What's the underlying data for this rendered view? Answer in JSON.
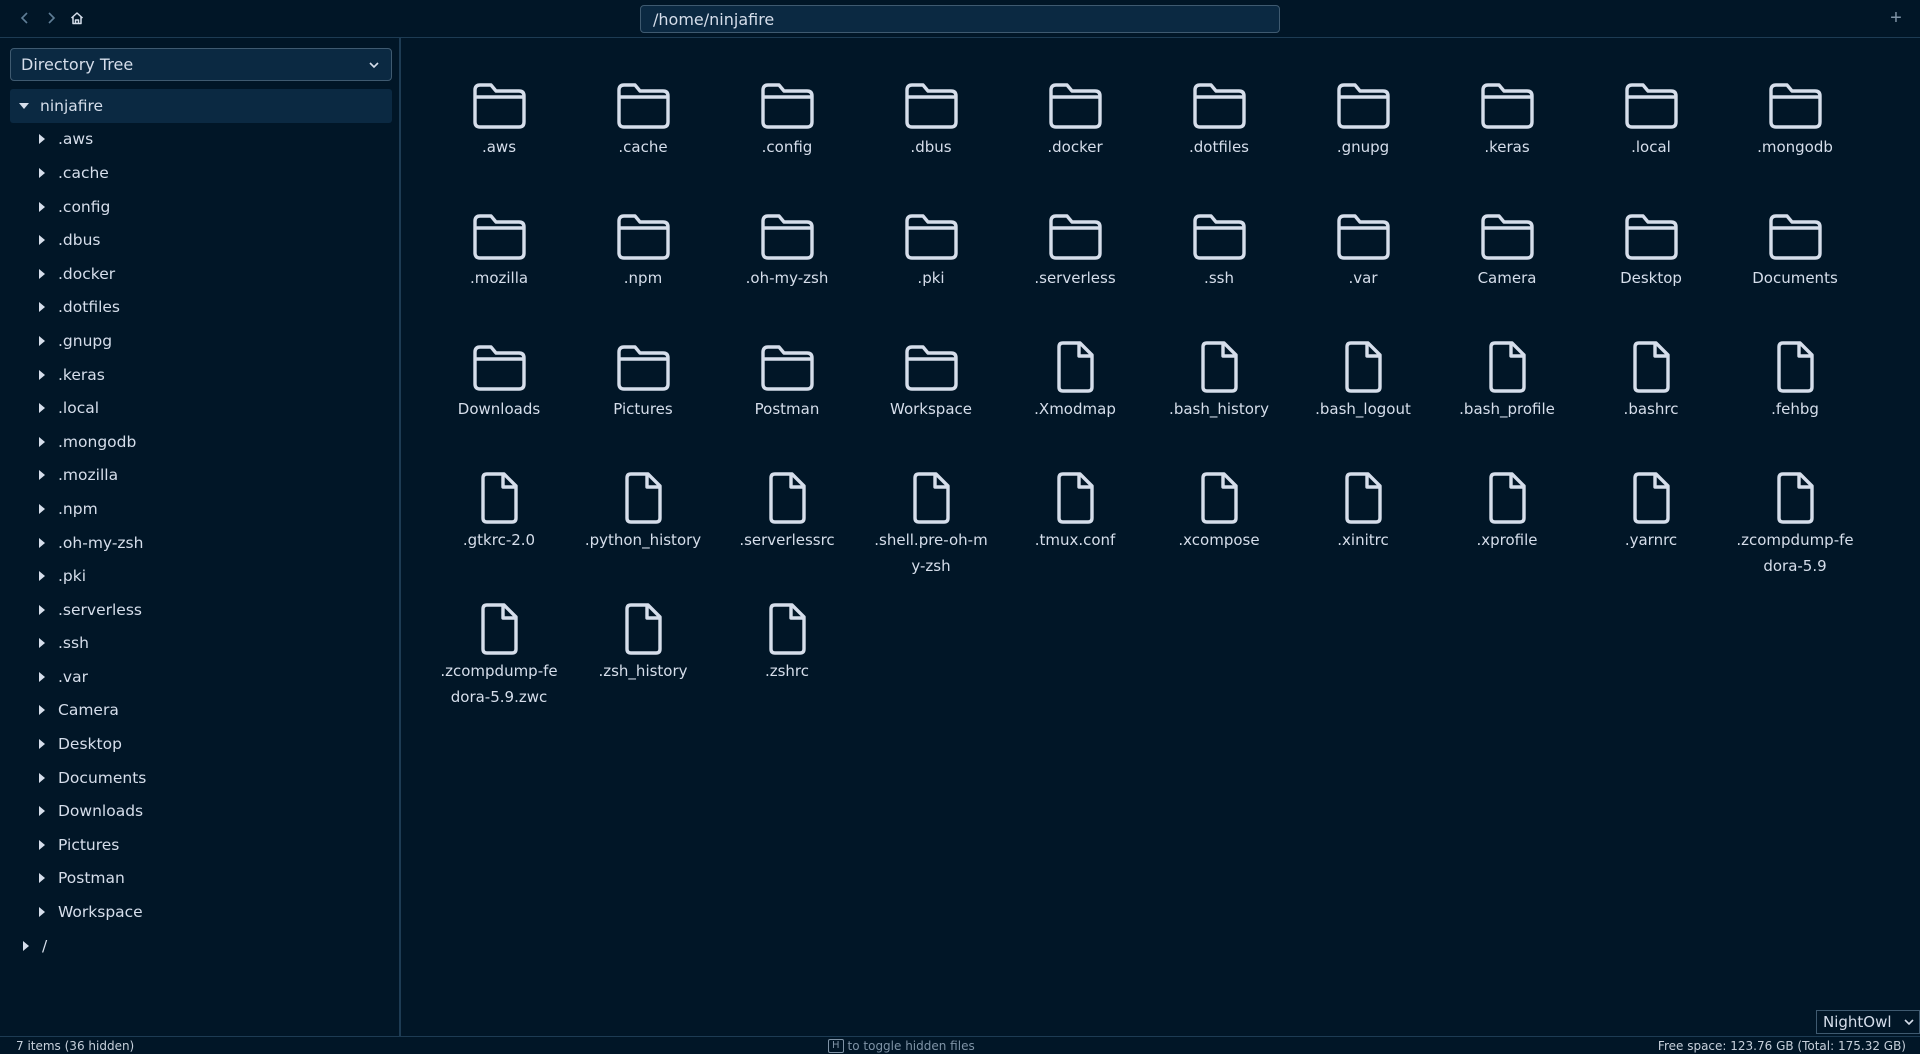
{
  "toolbar": {
    "path": "/home/ninjafire",
    "new_tab": "+"
  },
  "sidebar": {
    "mode": "Directory Tree",
    "root": "ninjafire",
    "children": [
      ".aws",
      ".cache",
      ".config",
      ".dbus",
      ".docker",
      ".dotfiles",
      ".gnupg",
      ".keras",
      ".local",
      ".mongodb",
      ".mozilla",
      ".npm",
      ".oh-my-zsh",
      ".pki",
      ".serverless",
      ".ssh",
      ".var",
      "Camera",
      "Desktop",
      "Documents",
      "Downloads",
      "Pictures",
      "Postman",
      "Workspace"
    ],
    "top_level": "/"
  },
  "files": [
    {
      "name": ".aws",
      "type": "folder"
    },
    {
      "name": ".cache",
      "type": "folder"
    },
    {
      "name": ".config",
      "type": "folder"
    },
    {
      "name": ".dbus",
      "type": "folder"
    },
    {
      "name": ".docker",
      "type": "folder"
    },
    {
      "name": ".dotfiles",
      "type": "folder"
    },
    {
      "name": ".gnupg",
      "type": "folder"
    },
    {
      "name": ".keras",
      "type": "folder"
    },
    {
      "name": ".local",
      "type": "folder"
    },
    {
      "name": ".mongodb",
      "type": "folder"
    },
    {
      "name": ".mozilla",
      "type": "folder"
    },
    {
      "name": ".npm",
      "type": "folder"
    },
    {
      "name": ".oh-my-zsh",
      "type": "folder"
    },
    {
      "name": ".pki",
      "type": "folder"
    },
    {
      "name": ".serverless",
      "type": "folder"
    },
    {
      "name": ".ssh",
      "type": "folder"
    },
    {
      "name": ".var",
      "type": "folder"
    },
    {
      "name": "Camera",
      "type": "folder"
    },
    {
      "name": "Desktop",
      "type": "folder"
    },
    {
      "name": "Documents",
      "type": "folder"
    },
    {
      "name": "Downloads",
      "type": "folder"
    },
    {
      "name": "Pictures",
      "type": "folder"
    },
    {
      "name": "Postman",
      "type": "folder"
    },
    {
      "name": "Workspace",
      "type": "folder"
    },
    {
      "name": ".Xmodmap",
      "type": "file"
    },
    {
      "name": ".bash_history",
      "type": "file"
    },
    {
      "name": ".bash_logout",
      "type": "file"
    },
    {
      "name": ".bash_profile",
      "type": "file"
    },
    {
      "name": ".bashrc",
      "type": "file"
    },
    {
      "name": ".fehbg",
      "type": "file"
    },
    {
      "name": ".gtkrc-2.0",
      "type": "file"
    },
    {
      "name": ".python_history",
      "type": "file"
    },
    {
      "name": ".serverlessrc",
      "type": "file"
    },
    {
      "name": ".shell.pre-oh-my-zsh",
      "type": "file"
    },
    {
      "name": ".tmux.conf",
      "type": "file"
    },
    {
      "name": ".xcompose",
      "type": "file"
    },
    {
      "name": ".xinitrc",
      "type": "file"
    },
    {
      "name": ".xprofile",
      "type": "file"
    },
    {
      "name": ".yarnrc",
      "type": "file"
    },
    {
      "name": ".zcompdump-fedora-5.9",
      "type": "file"
    },
    {
      "name": ".zcompdump-fedora-5.9.zwc",
      "type": "file"
    },
    {
      "name": ".zsh_history",
      "type": "file"
    },
    {
      "name": ".zshrc",
      "type": "file"
    }
  ],
  "theme": {
    "selected": "NightOwl"
  },
  "status": {
    "items": "7 items (36 hidden)",
    "hint_key": "H",
    "hint_text": "to toggle hidden files",
    "free_space": "Free space: 123.76 GB (Total: 175.32 GB)"
  },
  "colors": {
    "background": "#011627",
    "panel": "#0b2942",
    "border": "#1d3b53",
    "text": "#d6deeb",
    "icon": "#d6deeb",
    "muted": "#7f93a6"
  }
}
